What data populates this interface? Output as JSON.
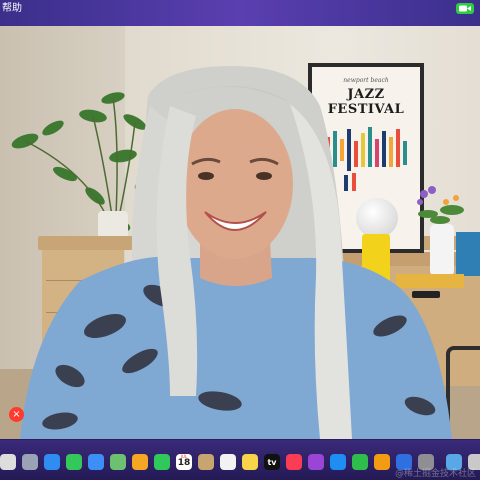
{
  "menubar": {
    "items": [
      "帮助"
    ],
    "camera_indicator": "video-camera-icon",
    "camera_indicator_color": "#2ecc40"
  },
  "video": {
    "poster": {
      "subtitle": "newport beach",
      "title": "JAZZ FESTIVAL"
    }
  },
  "call_controls": {
    "end_call_icon": "close-icon",
    "end_call_color": "#ff3b30",
    "end_call_glyph": "×"
  },
  "dock": {
    "items": [
      {
        "icon": "finder-icon",
        "color": "#ddd"
      },
      {
        "icon": "launchpad-icon",
        "color": "#9aa3b5"
      },
      {
        "icon": "safari-icon",
        "color": "#2f8cf0"
      },
      {
        "icon": "messages-icon",
        "color": "#34c759"
      },
      {
        "icon": "mail-icon",
        "color": "#3e8ef7"
      },
      {
        "icon": "maps-icon",
        "color": "#6cc070"
      },
      {
        "icon": "photos-icon",
        "color": "#f5a623"
      },
      {
        "icon": "facetime-icon",
        "color": "#30c85a"
      },
      {
        "icon": "calendar-icon",
        "color": "#ffffff",
        "month": "JUL",
        "day": "18"
      },
      {
        "icon": "contacts-icon",
        "color": "#c8a46e"
      },
      {
        "icon": "reminders-icon",
        "color": "#f2f2f2"
      },
      {
        "icon": "notes-icon",
        "color": "#f7d44a"
      },
      {
        "icon": "tv-icon",
        "color": "#111111",
        "label": "tv"
      },
      {
        "icon": "music-icon",
        "color": "#fa3c55"
      },
      {
        "icon": "podcasts-icon",
        "color": "#9b45d6"
      },
      {
        "icon": "app-store-icon",
        "color": "#1e8ef3"
      },
      {
        "icon": "numbers-icon",
        "color": "#2fbd4b"
      },
      {
        "icon": "pages-icon",
        "color": "#f39c12"
      },
      {
        "icon": "keynote-icon",
        "color": "#2f6fe0"
      },
      {
        "icon": "system-settings-icon",
        "color": "#8e8e93"
      },
      {
        "icon": "folder-icon",
        "color": "#5aa7e8"
      },
      {
        "icon": "trash-icon",
        "color": "#c9c9c9"
      }
    ]
  },
  "watermark": "@稀土掘金技术社区"
}
